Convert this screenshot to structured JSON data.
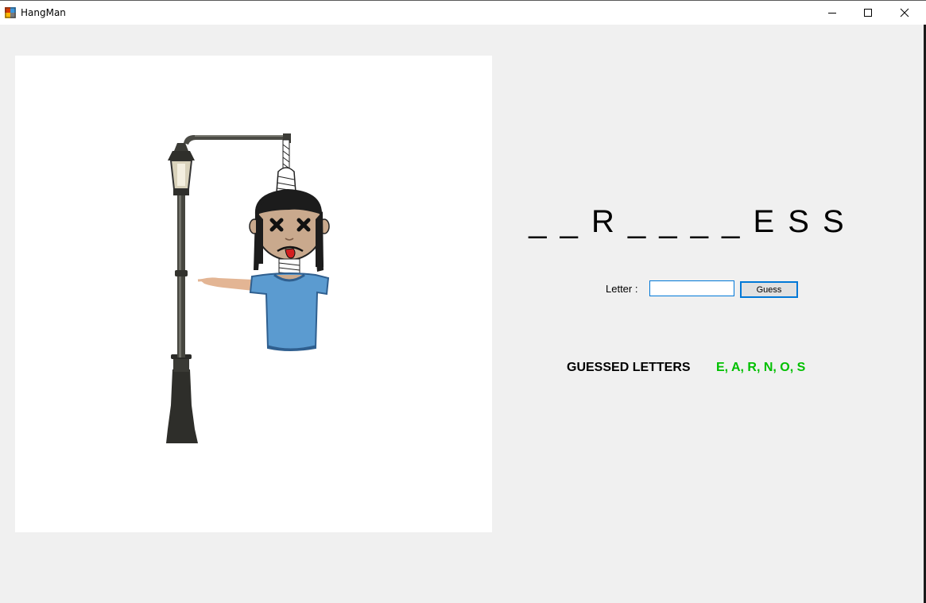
{
  "window": {
    "title": "HangMan",
    "app_icon": "winforms-app-icon",
    "controls": {
      "minimize_icon": "minimize-icon",
      "maximize_icon": "maximize-icon",
      "close_icon": "close-icon"
    }
  },
  "game": {
    "word_display": "_ _ R _ _ _ _ E S S",
    "letter_label": "Letter :",
    "letter_value": "",
    "guess_button_label": "Guess",
    "guessed_label": "GUESSED LETTERS",
    "guessed_letters": "E, A, R, N, O, S",
    "guessed_color": "#00c000",
    "picture": "hangman-lamppost-figure"
  },
  "colors": {
    "accent": "#0078d7",
    "shirt": "#5b9bd0",
    "hair": "#1c1c1c"
  }
}
